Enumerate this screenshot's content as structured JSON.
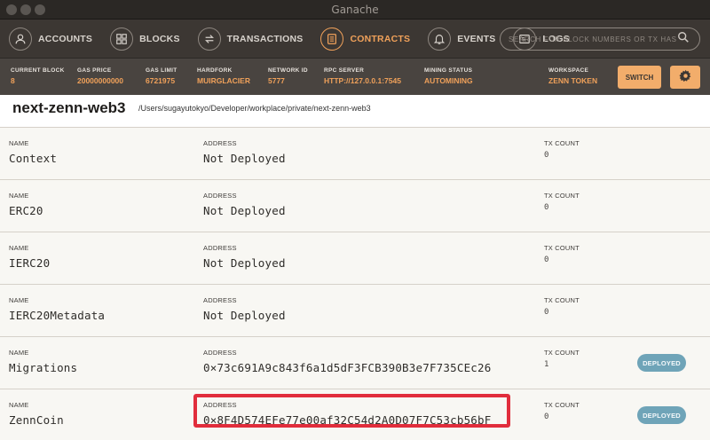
{
  "window": {
    "title": "Ganache"
  },
  "nav": {
    "items": [
      {
        "label": "ACCOUNTS",
        "icon": "accounts-icon"
      },
      {
        "label": "BLOCKS",
        "icon": "blocks-icon"
      },
      {
        "label": "TRANSACTIONS",
        "icon": "transactions-icon"
      },
      {
        "label": "CONTRACTS",
        "icon": "contracts-icon"
      },
      {
        "label": "EVENTS",
        "icon": "bell-icon"
      },
      {
        "label": "LOGS",
        "icon": "logs-icon"
      }
    ],
    "active": "CONTRACTS",
    "search_placeholder": "SEARCH FOR BLOCK NUMBERS OR TX HASHES"
  },
  "status": {
    "current_block": {
      "label": "CURRENT BLOCK",
      "value": "8"
    },
    "gas_price": {
      "label": "GAS PRICE",
      "value": "20000000000"
    },
    "gas_limit": {
      "label": "GAS LIMIT",
      "value": "6721975"
    },
    "hardfork": {
      "label": "HARDFORK",
      "value": "MUIRGLACIER"
    },
    "network_id": {
      "label": "NETWORK ID",
      "value": "5777"
    },
    "rpc_server": {
      "label": "RPC SERVER",
      "value": "HTTP://127.0.0.1:7545"
    },
    "mining_status": {
      "label": "MINING STATUS",
      "value": "AUTOMINING"
    },
    "workspace": {
      "label": "WORKSPACE",
      "value": "ZENN TOKEN"
    },
    "switch_label": "SWITCH"
  },
  "project": {
    "name": "next-zenn-web3",
    "path": "/Users/sugayutokyo/Developer/workplace/private/next-zenn-web3"
  },
  "columns": {
    "name": "NAME",
    "address": "ADDRESS",
    "tx_count": "TX COUNT"
  },
  "contracts": [
    {
      "name": "Context",
      "address": "Not Deployed",
      "tx_count": "0",
      "badge": ""
    },
    {
      "name": "ERC20",
      "address": "Not Deployed",
      "tx_count": "0",
      "badge": ""
    },
    {
      "name": "IERC20",
      "address": "Not Deployed",
      "tx_count": "0",
      "badge": ""
    },
    {
      "name": "IERC20Metadata",
      "address": "Not Deployed",
      "tx_count": "0",
      "badge": ""
    },
    {
      "name": "Migrations",
      "address": "0×73c691A9c843f6a1d5dF3FCB390B3e7F735CEc26",
      "tx_count": "1",
      "badge": "DEPLOYED"
    },
    {
      "name": "ZennCoin",
      "address": "0×8F4D574EFe77e00af32C54d2A0D07F7C53cb56bF",
      "tx_count": "0",
      "badge": "DEPLOYED"
    }
  ],
  "colors": {
    "accent": "#f0a15a",
    "badge": "#6fa4b8",
    "highlight": "#e12d3c"
  }
}
